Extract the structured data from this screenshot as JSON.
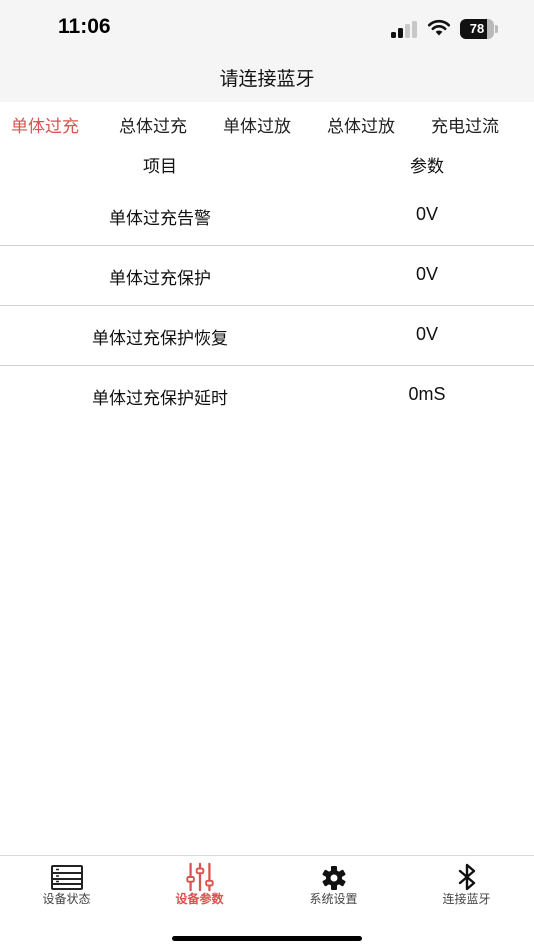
{
  "status_bar": {
    "time": "11:06",
    "battery_level": "78",
    "battery_fraction": 0.78
  },
  "nav": {
    "title": "请连接蓝牙"
  },
  "tabs": [
    {
      "label": "单体过充",
      "active": true
    },
    {
      "label": "总体过充",
      "active": false
    },
    {
      "label": "单体过放",
      "active": false
    },
    {
      "label": "总体过放",
      "active": false
    },
    {
      "label": "充电过流",
      "active": false
    }
  ],
  "table": {
    "headers": {
      "item": "项目",
      "value": "参数"
    },
    "rows": [
      {
        "item": "单体过充告警",
        "value": "0V"
      },
      {
        "item": "单体过充保护",
        "value": "0V"
      },
      {
        "item": "单体过充保护恢复",
        "value": "0V"
      },
      {
        "item": "单体过充保护延时",
        "value": "0mS"
      }
    ]
  },
  "bottom_tabs": [
    {
      "label": "设备状态",
      "icon": "device-status-icon",
      "active": false
    },
    {
      "label": "设备参数",
      "icon": "sliders-icon",
      "active": true
    },
    {
      "label": "系统设置",
      "icon": "gear-icon",
      "active": false
    },
    {
      "label": "连接蓝牙",
      "icon": "bluetooth-icon",
      "active": false
    }
  ],
  "colors": {
    "accent": "#d9534f",
    "bar_background": "#f5f5f5",
    "divider": "#d3d3d3"
  }
}
